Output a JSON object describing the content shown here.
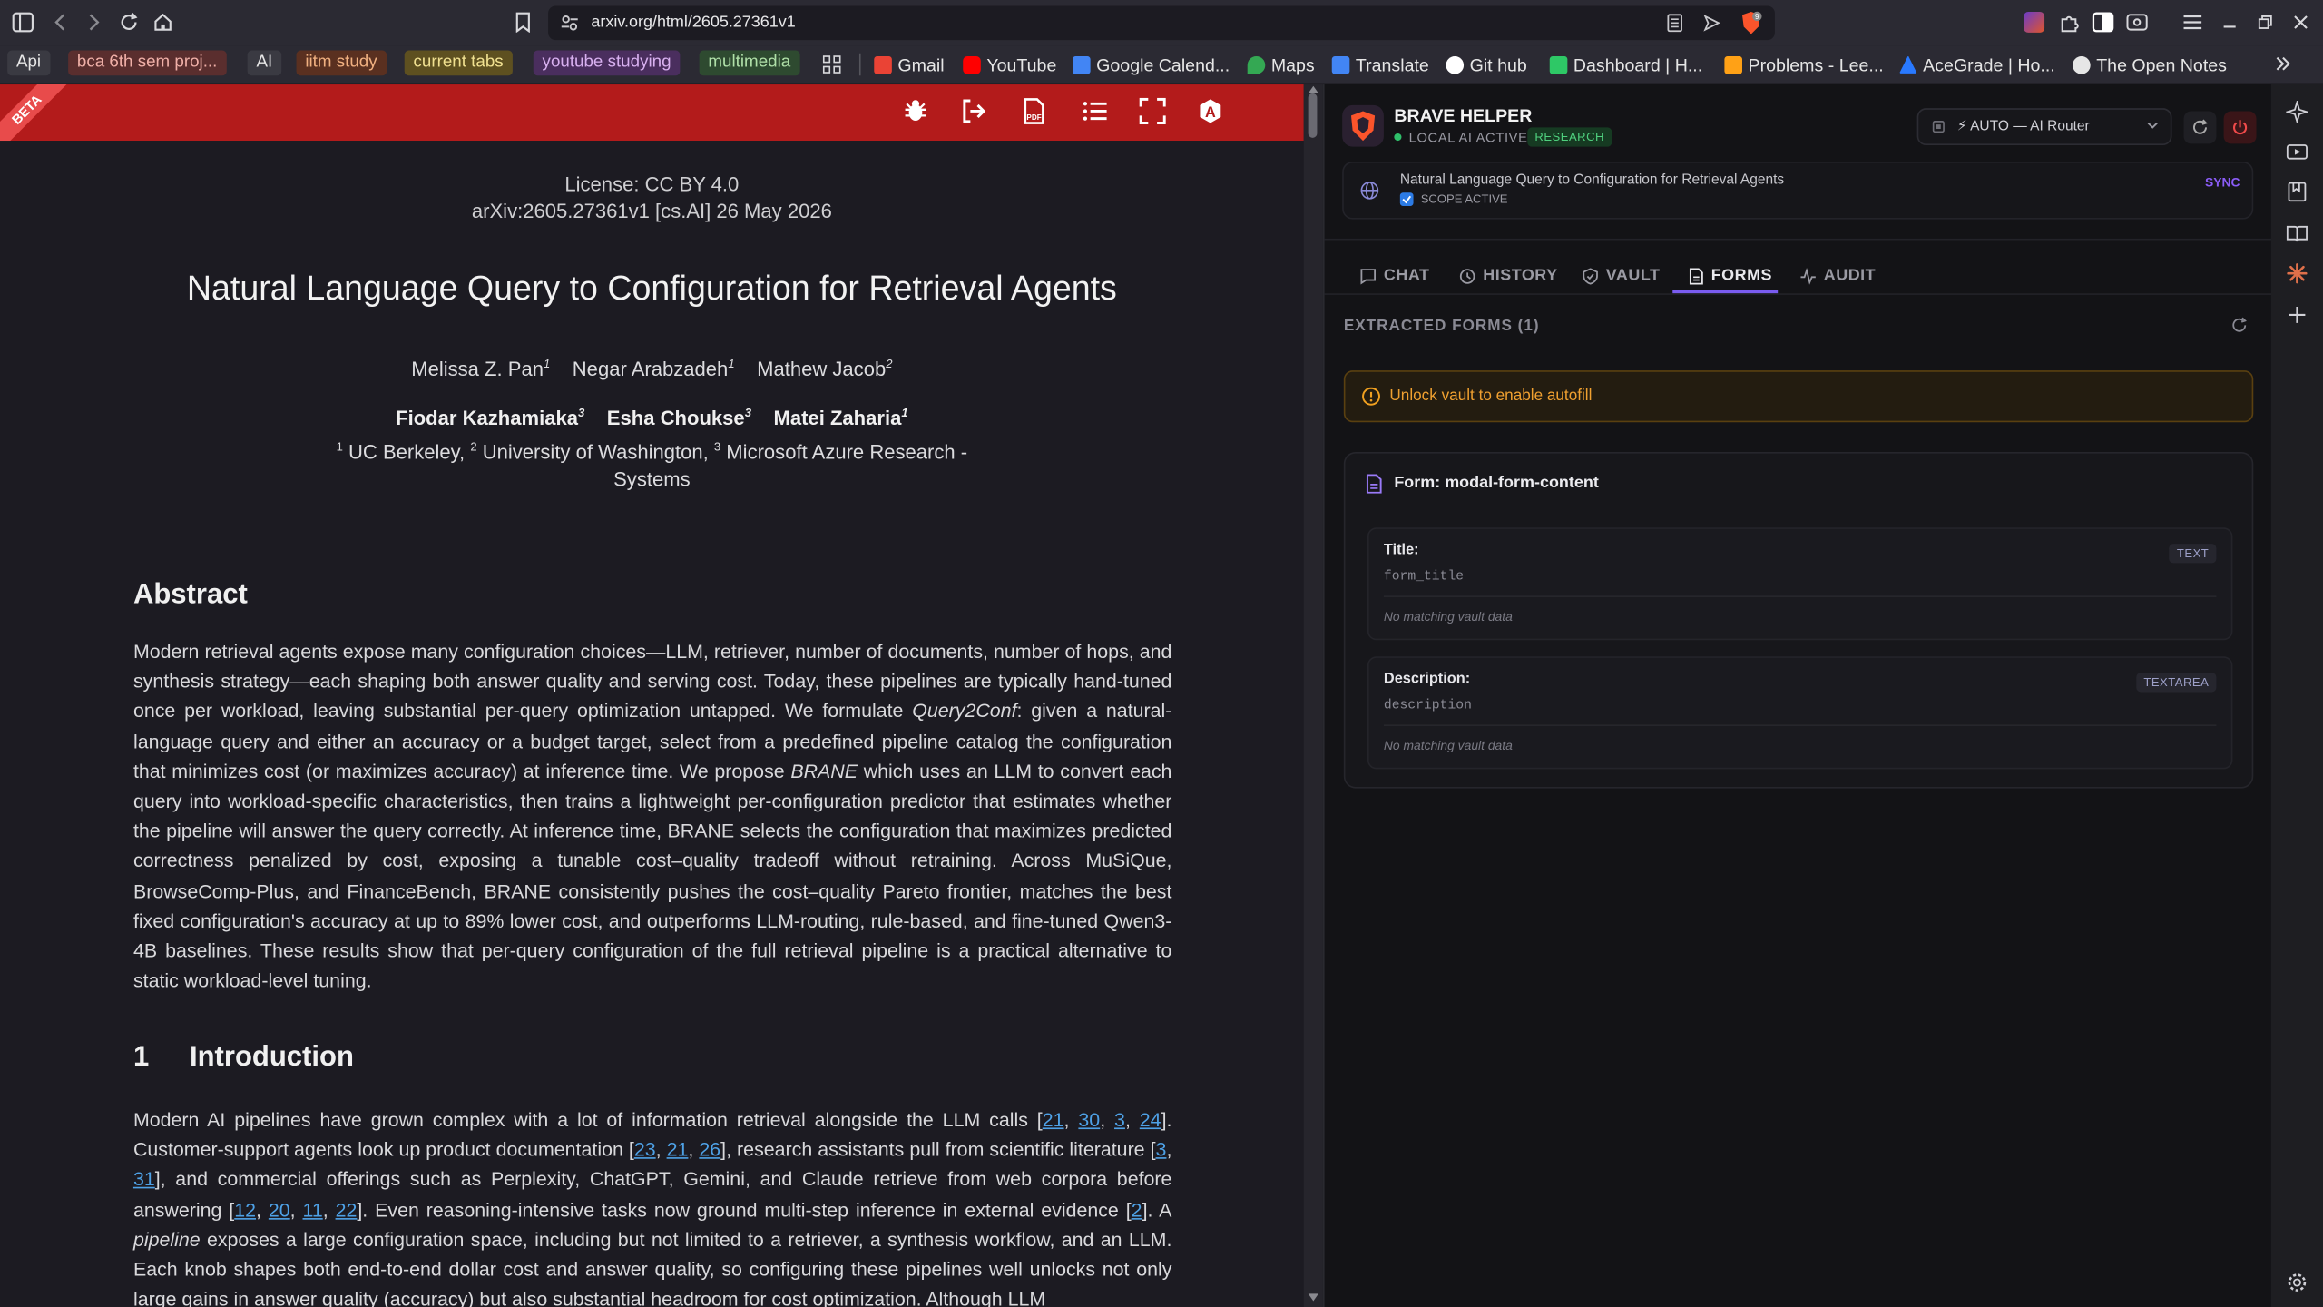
{
  "browser": {
    "url": "arxiv.org/html/2605.27361v1",
    "bookmark_chips": [
      {
        "label": "Api",
        "bg": "#3a3a42",
        "fg": "#e6e6e6"
      },
      {
        "label": "bca 6th sem proj...",
        "bg": "#5a2e2e",
        "fg": "#f0b0a8"
      },
      {
        "label": "AI",
        "bg": "#3a3a42",
        "fg": "#e6e6e6"
      },
      {
        "label": "iitm study",
        "bg": "#5a3020",
        "fg": "#f0b080"
      },
      {
        "label": "current tabs",
        "bg": "#5e5020",
        "fg": "#f0e090"
      },
      {
        "label": "youtube studying",
        "bg": "#4a2e5e",
        "fg": "#d8b0f0"
      },
      {
        "label": "multimedia",
        "bg": "#2e4a30",
        "fg": "#b0e0a8"
      }
    ],
    "bookmarks": [
      {
        "label": "Gmail",
        "icon": "gmail-icon",
        "color": "#ea4335"
      },
      {
        "label": "YouTube",
        "icon": "youtube-icon",
        "color": "#ff0000"
      },
      {
        "label": "Google Calend...",
        "icon": "calendar-icon",
        "color": "#4285f4"
      },
      {
        "label": "Maps",
        "icon": "maps-icon",
        "color": "#34a853"
      },
      {
        "label": "Translate",
        "icon": "translate-icon",
        "color": "#4285f4"
      },
      {
        "label": "Git hub",
        "icon": "github-icon",
        "color": "#ffffff"
      },
      {
        "label": "Dashboard | H...",
        "icon": "hackerrank-icon",
        "color": "#2ec866"
      },
      {
        "label": "Problems - Lee...",
        "icon": "leetcode-icon",
        "color": "#ffa116"
      },
      {
        "label": "AceGrade | Ho...",
        "icon": "acegrade-icon",
        "color": "#2979ff"
      },
      {
        "label": "The Open Notes",
        "icon": "opennotes-icon",
        "color": "#e6e6e6"
      }
    ]
  },
  "paper": {
    "license": "License: CC BY 4.0",
    "arxiv_id": "arXiv:2605.27361v1 [cs.AI] 26 May 2026",
    "title": "Natural Language Query to Configuration for Retrieval Agents",
    "authors_row1": [
      {
        "name": "Melissa Z. Pan",
        "sup": "1"
      },
      {
        "name": "Negar Arabzadeh",
        "sup": "1"
      },
      {
        "name": "Mathew Jacob",
        "sup": "2"
      }
    ],
    "authors_row2": [
      {
        "name": "Fiodar Kazhamiaka",
        "sup": "3"
      },
      {
        "name": "Esha Choukse",
        "sup": "3"
      },
      {
        "name": "Matei Zaharia",
        "sup": "1"
      }
    ],
    "affil_s1": "1",
    "affil_t1": " UC Berkeley, ",
    "affil_s2": "2",
    "affil_t2": " University of Washington, ",
    "affil_s3": "3",
    "affil_t3": " Microsoft Azure Research -",
    "affil_line2": "Systems",
    "abstract_heading": "Abstract",
    "abstract": {
      "p1": "Modern retrieval agents expose many configuration choices—LLM, retriever, number of documents, number of hops, and synthesis strategy—each shaping both answer quality and serving cost. Today, these pipelines are typically hand-tuned once per workload, leaving substantial per-query optimization untapped. We formulate ",
      "q2c": "Query2Conf",
      "p2": ": given a natural-language query and either an accuracy or a budget target, select from a predefined pipeline catalog the configuration that minimizes cost (or maximizes accuracy) at inference time. We propose ",
      "brane": "BRANE",
      "p3": " which uses an LLM to convert each query into workload-specific characteristics, then trains a lightweight per-configuration predictor that estimates whether the pipeline will answer the query correctly. At inference time, BRANE selects the configuration that maximizes predicted correctness penalized by cost, exposing a tunable cost–quality tradeoff without retraining. Across MuSiQue, BrowseComp-Plus, and FinanceBench, BRANE consistently pushes the cost–quality Pareto frontier, matches the best fixed configuration's accuracy at up to 89% lower cost, and outperforms LLM-routing, rule-based, and fine-tuned Qwen3-4B baselines. These results show that per-query configuration of the full retrieval pipeline is a practical alternative to static workload-level tuning."
    },
    "intro_num": "1",
    "intro_heading": "Introduction",
    "intro": {
      "t1": "Modern AI pipelines have grown complex with a lot of information retrieval alongside the LLM calls [",
      "c1": "21",
      "s1": ", ",
      "c2": "30",
      "s2": ", ",
      "c3": "3",
      "s3": ", ",
      "c4": "24",
      "t2": "]. Customer-support agents look up product documentation [",
      "c5": "23",
      "s5": ", ",
      "c6": "21",
      "s6": ", ",
      "c7": "26",
      "t3": "], research assistants pull from scientific literature [",
      "c8": "3",
      "s8": ", ",
      "c9": "31",
      "t4": "], and commercial offerings such as Perplexity, ChatGPT, Gemini, and Claude retrieve from web corpora before answering [",
      "c10": "12",
      "s10": ", ",
      "c11": "20",
      "s11": ", ",
      "c12": "11",
      "s12": ", ",
      "c13": "22",
      "t5": "]. Even reasoning-intensive tasks now ground multi-step inference in external evidence [",
      "c14": "2",
      "t6": "]. A ",
      "pipeline": "pipeline",
      "t7": " exposes a large configuration space, including but not limited to a retriever, a synthesis workflow, and an LLM. Each knob shapes both end-to-end dollar cost and answer quality, so configuring these pipelines well unlocks not only large gains in answer quality (accuracy) but also substantial headroom for cost optimization. Although LLM"
    }
  },
  "panel": {
    "name": "BRAVE HELPER",
    "status": "LOCAL AI ACTIVE",
    "badge": "RESEARCH",
    "router": "⚡ AUTO — AI Router",
    "scope_title": "Natural Language Query to Configuration for Retrieval Agents",
    "scope_status": "SCOPE ACTIVE",
    "sync": "SYNC",
    "tabs": [
      "CHAT",
      "HISTORY",
      "VAULT",
      "FORMS",
      "AUDIT"
    ],
    "active_tab": "FORMS",
    "section_title": "EXTRACTED FORMS (1)",
    "warning": "Unlock vault to enable autofill",
    "form_title": "Form: modal-form-content",
    "fields": [
      {
        "label": "Title:",
        "name": "form_title",
        "type": "TEXT",
        "status": "No matching vault data"
      },
      {
        "label": "Description:",
        "name": "description",
        "type": "TEXTAREA",
        "status": "No matching vault data"
      }
    ]
  }
}
